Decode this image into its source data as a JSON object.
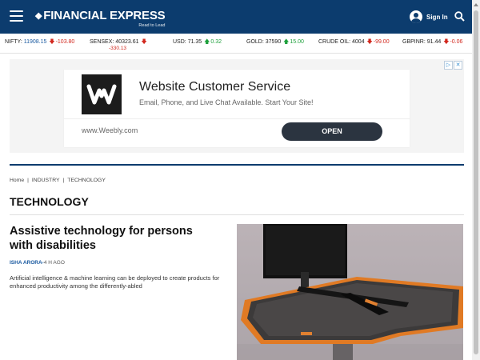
{
  "header": {
    "logo_text": "FINANCIAL EXPRESS",
    "logo_tagline": "Read to Lead",
    "signin_label": "Sign In",
    "icons": {
      "menu": "hamburger-menu-icon",
      "user": "user-icon",
      "search": "search-icon"
    },
    "bg_color": "#0c3c6e"
  },
  "ticker": [
    {
      "label": "NIFTY:",
      "value": "11908.15",
      "change": "-103.80",
      "direction": "down"
    },
    {
      "label": "SENSEX:",
      "value": "40323.61",
      "change": "-330.13",
      "direction": "down"
    },
    {
      "label": "USD:",
      "value": "71.35",
      "change": "0.32",
      "direction": "up"
    },
    {
      "label": "GOLD:",
      "value": "37590",
      "change": "15.00",
      "direction": "up"
    },
    {
      "label": "CRUDE OIL:",
      "value": "4004",
      "change": "-99.00",
      "direction": "down"
    },
    {
      "label": "GBPINR:",
      "value": "91.44",
      "change": "-0.06",
      "direction": "down"
    }
  ],
  "ad": {
    "title": "Website Customer Service",
    "subtitle": "Email, Phone, and Live Chat Available. Start Your Site!",
    "url": "www.Weebly.com",
    "button_label": "OPEN",
    "close_glyphs": [
      "▷",
      "✕"
    ]
  },
  "breadcrumb": [
    "Home",
    "INDUSTRY",
    "TECHNOLOGY"
  ],
  "breadcrumb_sep": "|",
  "section_title": "TECHNOLOGY",
  "article": {
    "headline": "Assistive technology for persons with disabilities",
    "author": "ISHA ARORA",
    "time": "4 H AGO",
    "summary": "Artificial intelligence & machine learning can be deployed to create products for enhanced productivity among the differently-abled"
  },
  "colors": {
    "down": "#d2281e",
    "up": "#1ea03c",
    "link": "#1a5aa0"
  }
}
